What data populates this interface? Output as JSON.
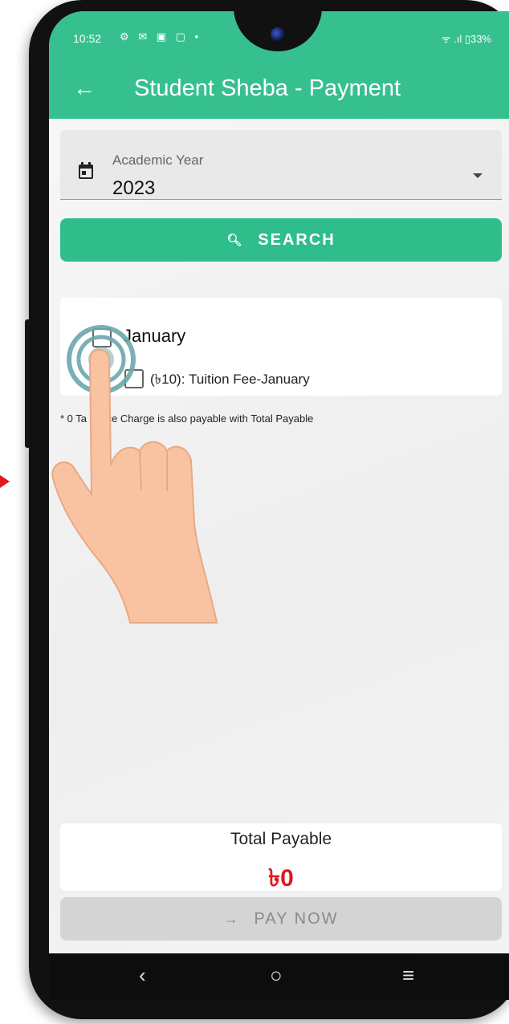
{
  "status": {
    "time": "10:52",
    "left_icons": "⚙ ✉ ▣ ▢ •",
    "right_icons": "ᯤ .ıl ▯33%"
  },
  "appbar": {
    "back_icon": "arrow-left-icon",
    "title": "Student Sheba - Payment"
  },
  "academic_year": {
    "label": "Academic Year",
    "value": "2023"
  },
  "search": {
    "label": "SEARCH"
  },
  "fees": {
    "month": "January",
    "items": [
      {
        "label": "(৳10): Tuition Fee-January"
      }
    ]
  },
  "note": "* 0 Ta    ervice Charge is also payable with Total Payable",
  "total": {
    "label": "Total Payable",
    "amount": "৳0"
  },
  "pay": {
    "label": "PAY NOW"
  },
  "navbar": {
    "back": "‹",
    "home": "○",
    "recents": "≡"
  },
  "colors": {
    "primary": "#37c08f",
    "amount": "#e01a1a",
    "disabled_button": "#d4d4d4"
  }
}
